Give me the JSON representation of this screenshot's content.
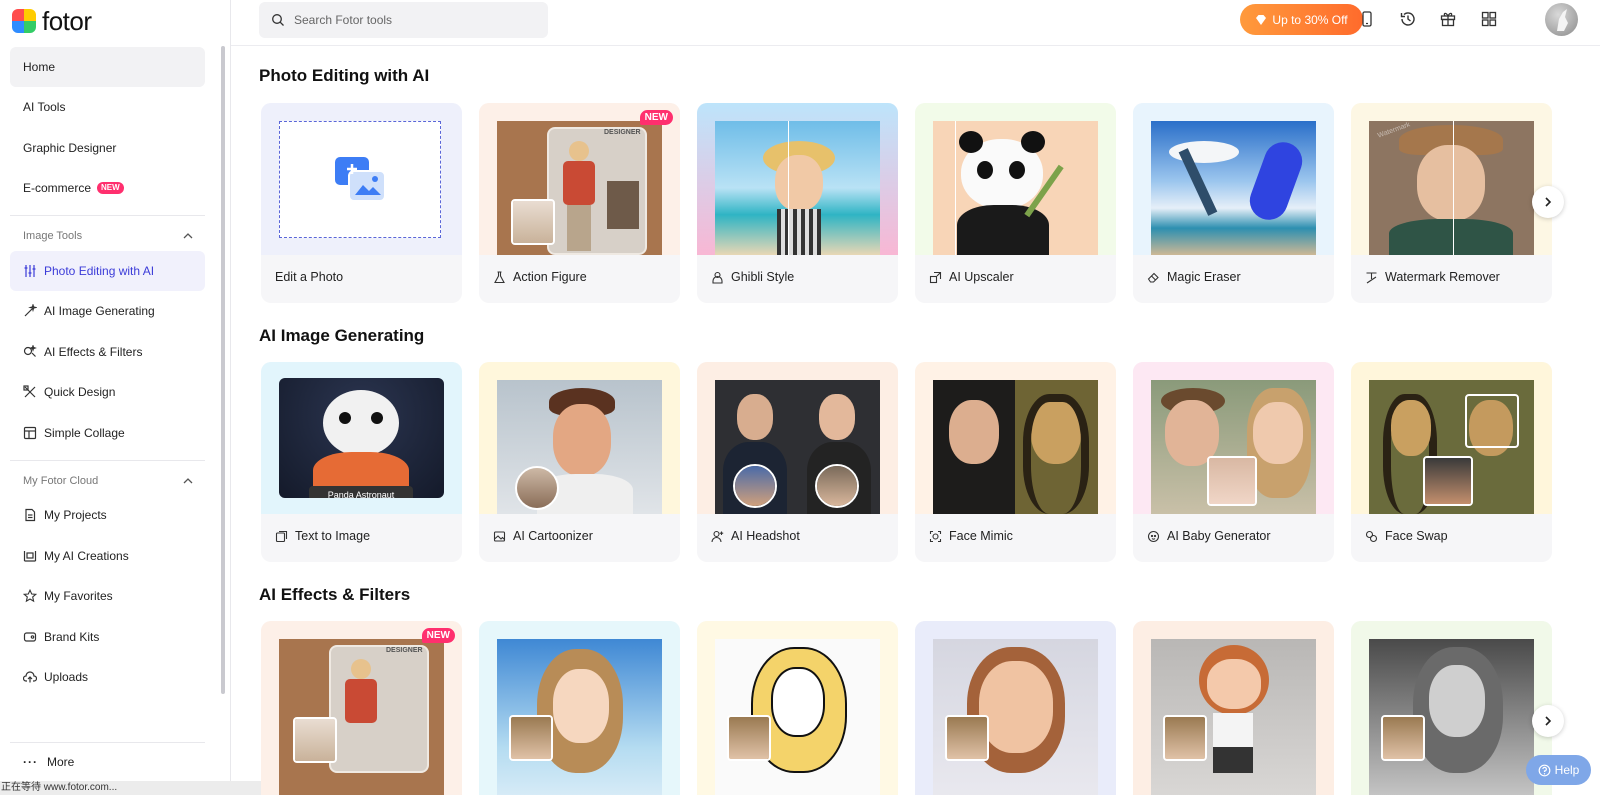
{
  "app": {
    "logo_text": "fotor"
  },
  "search": {
    "placeholder": "Search Fotor tools"
  },
  "header": {
    "promo_label": "Up to 30% Off",
    "icons": [
      "mobile-icon",
      "history-icon",
      "gift-icon",
      "apps-grid-icon",
      "user-avatar"
    ]
  },
  "sidebar": {
    "main_items": [
      {
        "label": "Home"
      },
      {
        "label": "AI Tools"
      },
      {
        "label": "Graphic Designer"
      },
      {
        "label": "E-commerce",
        "badge": "NEW"
      }
    ],
    "image_tools_title": "Image Tools",
    "image_tools": [
      {
        "label": "Photo Editing with AI",
        "icon": "sliders-icon"
      },
      {
        "label": "AI Image Generating",
        "icon": "magic-wand-icon"
      },
      {
        "label": "AI Effects & Filters",
        "icon": "effects-icon"
      },
      {
        "label": "Quick Design",
        "icon": "design-tools-icon"
      },
      {
        "label": "Simple Collage",
        "icon": "collage-icon"
      }
    ],
    "cloud_title": "My Fotor Cloud",
    "cloud_items": [
      {
        "label": "My Projects",
        "icon": "document-icon"
      },
      {
        "label": "My AI Creations",
        "icon": "creations-icon"
      },
      {
        "label": "My Favorites",
        "icon": "star-icon"
      },
      {
        "label": "Brand Kits",
        "icon": "brand-kit-icon"
      },
      {
        "label": "Uploads",
        "icon": "upload-cloud-icon"
      }
    ],
    "more_label": "More"
  },
  "status_bar": "正在等待 www.fotor.com...",
  "sections": [
    {
      "title": "Photo Editing with AI",
      "cards": [
        {
          "label": "Edit a Photo"
        },
        {
          "label": "Action Figure",
          "badge": "NEW"
        },
        {
          "label": "Ghibli Style"
        },
        {
          "label": "AI Upscaler"
        },
        {
          "label": "Magic Eraser"
        },
        {
          "label": "Watermark Remover"
        }
      ]
    },
    {
      "title": "AI Image Generating",
      "cards": [
        {
          "label": "Text to Image",
          "caption": "Panda Astronaut"
        },
        {
          "label": "AI Cartoonizer"
        },
        {
          "label": "AI Headshot"
        },
        {
          "label": "Face Mimic"
        },
        {
          "label": "AI Baby Generator"
        },
        {
          "label": "Face Swap"
        }
      ]
    },
    {
      "title": "AI Effects & Filters",
      "cards": [
        {
          "badge": "NEW"
        },
        {},
        {},
        {},
        {},
        {}
      ]
    }
  ],
  "card_image_texts": {
    "designer_box": "DESIGNER",
    "watermark": "Watermark"
  },
  "help_label": "Help",
  "colors": {
    "accent": "#3b3bd8",
    "new_badge": "#ff2f6e",
    "promo_start": "#ff9a3c",
    "promo_end": "#ff6b2c"
  }
}
